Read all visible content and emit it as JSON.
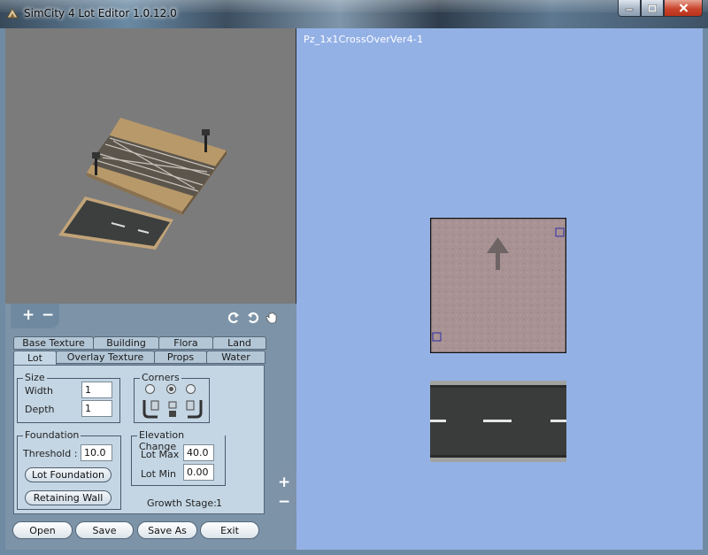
{
  "window": {
    "title": "SimCity 4 Lot Editor 1.0.12.0"
  },
  "canvas": {
    "lot_name": "Pz_1x1CrossOverVer4-1"
  },
  "preview": {
    "zoom_in": "+",
    "zoom_out": "−"
  },
  "side_zoom": {
    "zoom_in": "+",
    "zoom_out": "−"
  },
  "tabs": {
    "back_row": [
      "Base Texture",
      "Building",
      "Flora",
      "Land"
    ],
    "front_row": [
      "Lot",
      "Overlay Texture",
      "Props",
      "Water"
    ],
    "active": "Lot"
  },
  "size": {
    "legend": "Size",
    "width_label": "Width",
    "width_value": "1",
    "depth_label": "Depth",
    "depth_value": "1"
  },
  "corners": {
    "legend": "Corners",
    "selected_index": 1
  },
  "foundation": {
    "legend": "Foundation",
    "threshold_label": "Threshold :",
    "threshold_value": "10.0",
    "lot_foundation_button": "Lot Foundation",
    "retaining_wall_button": "Retaining Wall"
  },
  "elevation": {
    "legend": "Elevation Change",
    "max_label": "Lot Max",
    "max_value": "40.0",
    "min_label": "Lot Min",
    "min_value": "0.00"
  },
  "growth": {
    "label": "Growth Stage:",
    "value": "1"
  },
  "actions": {
    "open": "Open",
    "save": "Save",
    "save_as": "Save As",
    "exit": "Exit"
  },
  "colors": {
    "canvas_bg": "#94b1e6",
    "panel_bg": "#7d93a7",
    "tab_bg": "#c4d6e4",
    "preview_bg": "#7b7b7b"
  }
}
